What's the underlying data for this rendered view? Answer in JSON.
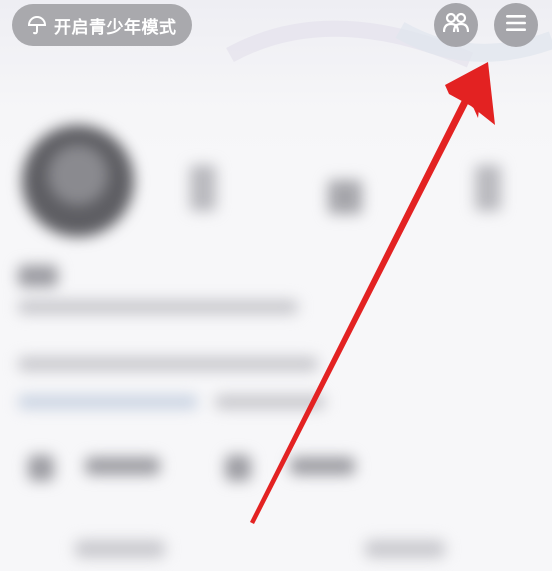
{
  "top_bar": {
    "teen_mode_label": "开启青少年模式",
    "teen_mode_icon": "umbrella-icon",
    "friends_icon": "friends-icon",
    "menu_icon": "hamburger-menu-icon"
  },
  "annotation": {
    "arrow_color": "#e32222"
  },
  "colors": {
    "pill_bg": "#a9a9ad",
    "button_bg": "#a5a5aa",
    "page_bg": "#f7f7f9"
  }
}
